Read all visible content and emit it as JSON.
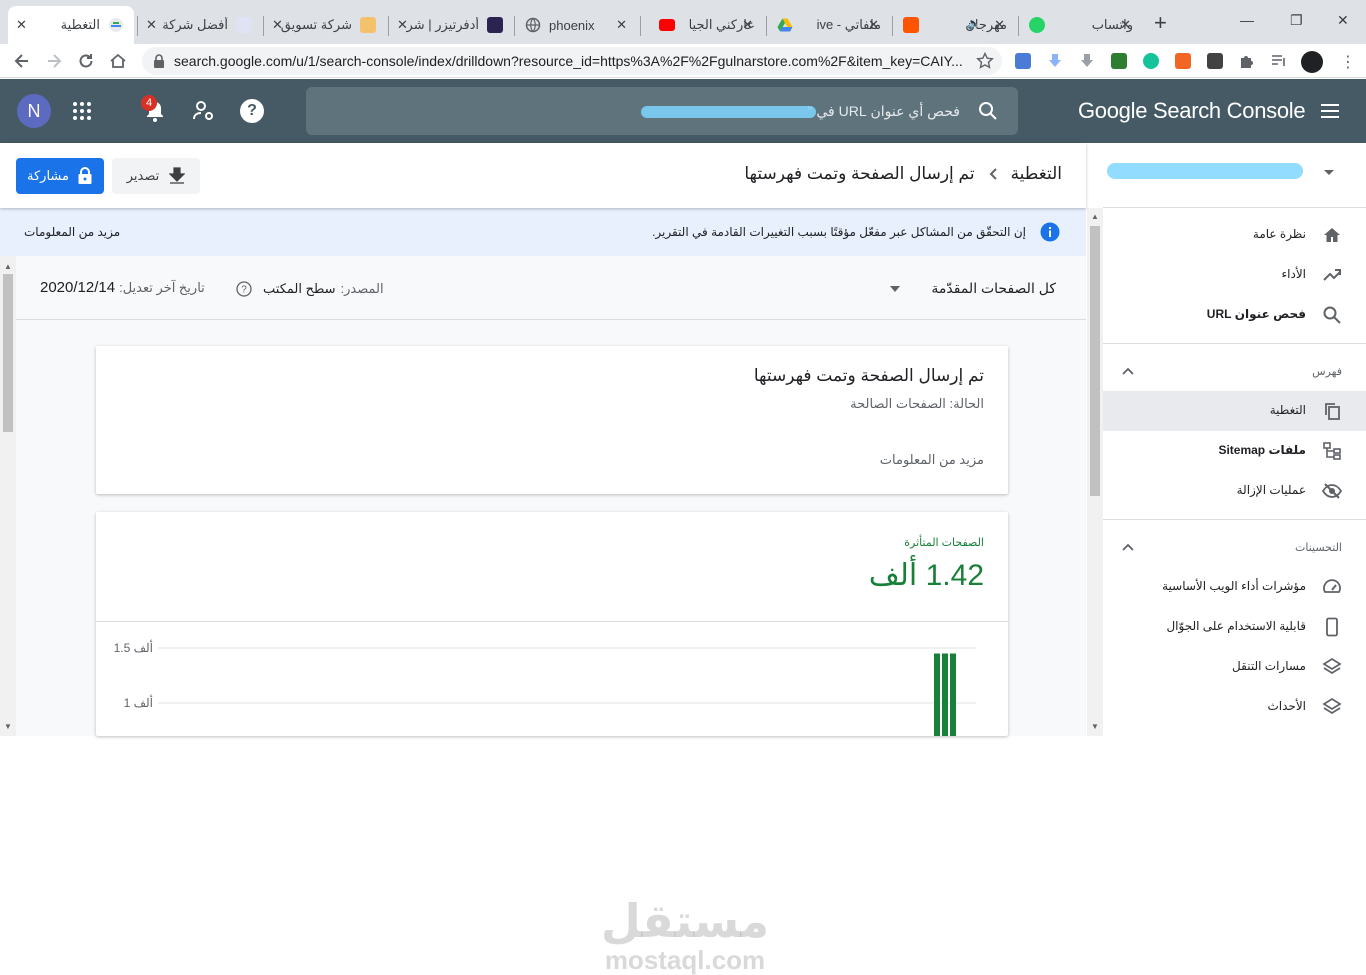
{
  "browser": {
    "tabs": [
      {
        "title": "التغطية",
        "active": true,
        "favicon": "search-console-icon"
      },
      {
        "title": "أفضل شركة",
        "favicon": "site-icon"
      },
      {
        "title": "شركة تسويق",
        "favicon": "site-icon"
      },
      {
        "title": "أدفرتيزر | شر",
        "favicon": "site-icon"
      },
      {
        "title": "phoenix",
        "favicon": "globe-icon"
      },
      {
        "title": "عاركني الجيا",
        "favicon": "youtube-icon"
      },
      {
        "title": "ملفاتي - ive",
        "favicon": "drive-icon"
      },
      {
        "title": "مهرجان",
        "favicon": "soundcloud-icon"
      },
      {
        "title": "واتساب",
        "favicon": "whatsapp-icon"
      }
    ],
    "url": "search.google.com/u/1/search-console/index/drilldown?resource_id=https%3A%2F%2Fgulnarstore.com%2F&item_key=CAIY..."
  },
  "header": {
    "avatar_letter": "N",
    "notification_count": "4",
    "search_placeholder": "فحص أي عنوان URL في \"",
    "brand": "Google Search Console"
  },
  "sidebar": {
    "items_top": [
      {
        "label": "نظرة عامة",
        "icon": "home-icon"
      },
      {
        "label": "الأداء",
        "icon": "trending-up-icon"
      },
      {
        "label": "فحص عنوان URL",
        "icon": "search-icon"
      }
    ],
    "section_index": "فهرس",
    "items_index": [
      {
        "label": "التغطية",
        "icon": "copy-pages-icon",
        "active": true
      },
      {
        "label": "ملفات Sitemap",
        "icon": "sitemap-icon"
      },
      {
        "label": "عمليات الإزالة",
        "icon": "visibility-off-icon"
      }
    ],
    "section_enhancements": "التحسينات",
    "items_enhancements": [
      {
        "label": "مؤشرات أداء الويب الأساسية",
        "icon": "speed-gauge-icon"
      },
      {
        "label": "قابلية الاستخدام على الجوّال",
        "icon": "smartphone-icon"
      },
      {
        "label": "مسارات التنقل",
        "icon": "layers-icon"
      },
      {
        "label": "الأحداث",
        "icon": "layers-icon"
      }
    ]
  },
  "page": {
    "breadcrumb_root": "التغطية",
    "breadcrumb_current": "تم إرسال الصفحة وتمت فهرستها",
    "export_label": "تصدير",
    "share_label": "مشاركة"
  },
  "banner": {
    "text": "إن التحقّق من المشاكل عبر مفعّل مؤقتًا بسبب التغييرات القادمة في التقرير.",
    "link": "مزيد من المعلومات"
  },
  "filter": {
    "selector": "كل الصفحات المقدّمة",
    "source_label": "المصدر:",
    "source_value": "سطح المكتب",
    "last_update_label": "تاريخ آخر تعديل:",
    "last_update_value": "2020/12/14"
  },
  "card_status": {
    "title": "تم إرسال الصفحة وتمت فهرستها",
    "status": "الحالة: الصفحات الصالحة",
    "more": "مزيد من المعلومات"
  },
  "card_affected": {
    "label": "الصفحات المتأثرة",
    "value": "1.42 ألف"
  },
  "chart_data": {
    "type": "bar",
    "y_ticks": [
      "1.5 ألف",
      "1 ألف"
    ],
    "ylim": [
      0,
      1.5
    ],
    "series": [
      {
        "values": [
          1.45,
          1.45,
          1.45
        ]
      }
    ],
    "color": "#188038",
    "grid": true
  },
  "watermark": {
    "arabic": "مستقل",
    "latin": "mostaql.com"
  }
}
